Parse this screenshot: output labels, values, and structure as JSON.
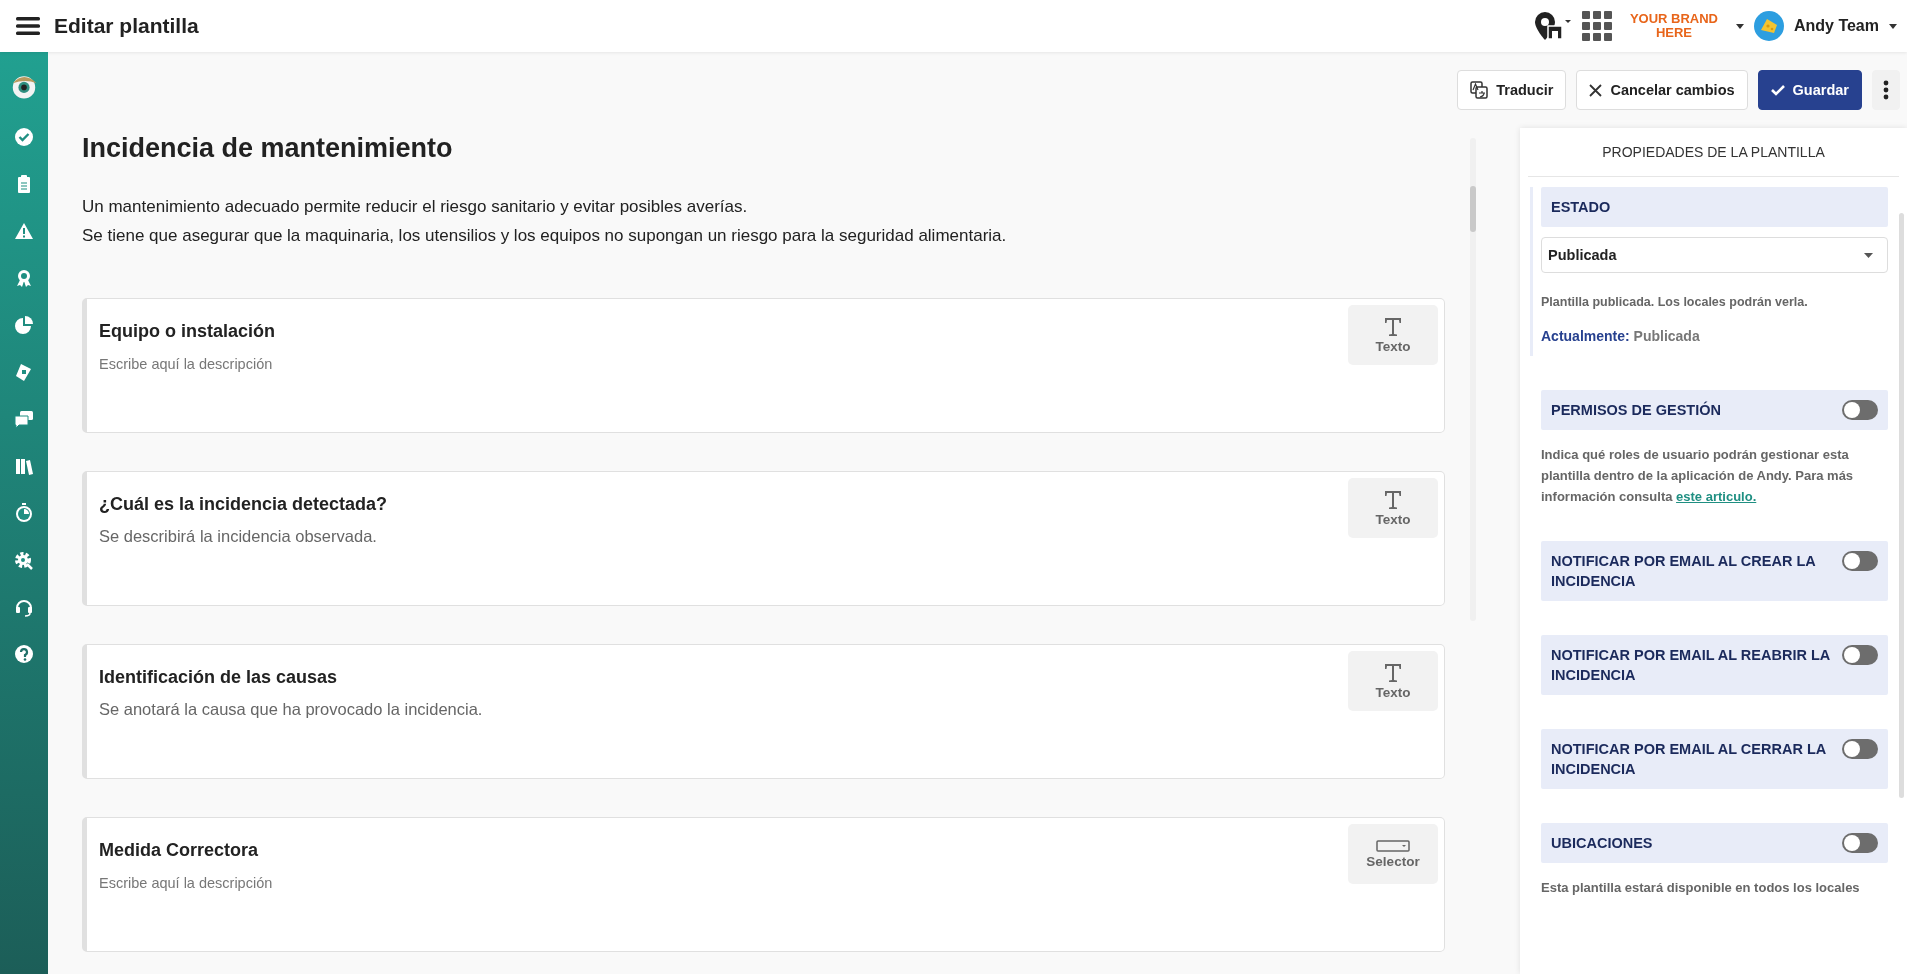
{
  "header": {
    "title": "Editar plantilla",
    "brand": "YOUR BRAND HERE",
    "user": "Andy Team"
  },
  "actions": [
    {
      "kind": "translate",
      "label": "Traducir"
    },
    {
      "kind": "cancel",
      "label": "Cancelar cambios"
    },
    {
      "kind": "save",
      "label": "Guardar"
    },
    {
      "kind": "more"
    }
  ],
  "template": {
    "title": "Incidencia de mantenimiento",
    "description": [
      "Un mantenimiento adecuado permite reducir el riesgo sanitario y evitar posibles averías.",
      "Se tiene que asegurar que la maquinaria, los utensilios y los equipos no supongan un riesgo para la seguridad alimentaria."
    ],
    "fields": [
      {
        "title": "Equipo o instalación",
        "placeholder": "Escribe aquí la descripción",
        "kind": "text",
        "type_label": "Texto"
      },
      {
        "title": "¿Cuál es la incidencia detectada?",
        "description": "Se describirá la incidencia observada.",
        "kind": "text",
        "type_label": "Texto"
      },
      {
        "title": "Identificación de las causas",
        "description": "Se anotará la causa que ha provocado la incidencia.",
        "kind": "text",
        "type_label": "Texto"
      },
      {
        "title": "Medida Correctora",
        "placeholder": "Escribe aquí la descripción",
        "kind": "selector",
        "type_label": "Selector"
      }
    ]
  },
  "properties": {
    "title": "PROPIEDADES DE LA PLANTILLA",
    "status": {
      "heading": "ESTADO",
      "value": "Publicada",
      "help": "Plantilla publicada. Los locales podrán verla.",
      "current_label": "Actualmente:",
      "current_value": "Publicada"
    },
    "sections": [
      {
        "heading": "PERMISOS DE GESTIÓN",
        "on": false,
        "description": "Indica qué roles de usuario podrán gestionar esta plantilla dentro de la aplicación de Andy. Para más información consulta",
        "link": "este articulo."
      },
      {
        "heading": "NOTIFICAR POR EMAIL AL CREAR LA INCIDENCIA",
        "on": false
      },
      {
        "heading": "NOTIFICAR POR EMAIL AL REABRIR LA INCIDENCIA",
        "on": false
      },
      {
        "heading": "NOTIFICAR POR EMAIL AL CERRAR LA INCIDENCIA",
        "on": false
      },
      {
        "heading": "UBICACIONES",
        "on": false,
        "description": "Esta plantilla estará disponible en todos los locales"
      }
    ]
  }
}
